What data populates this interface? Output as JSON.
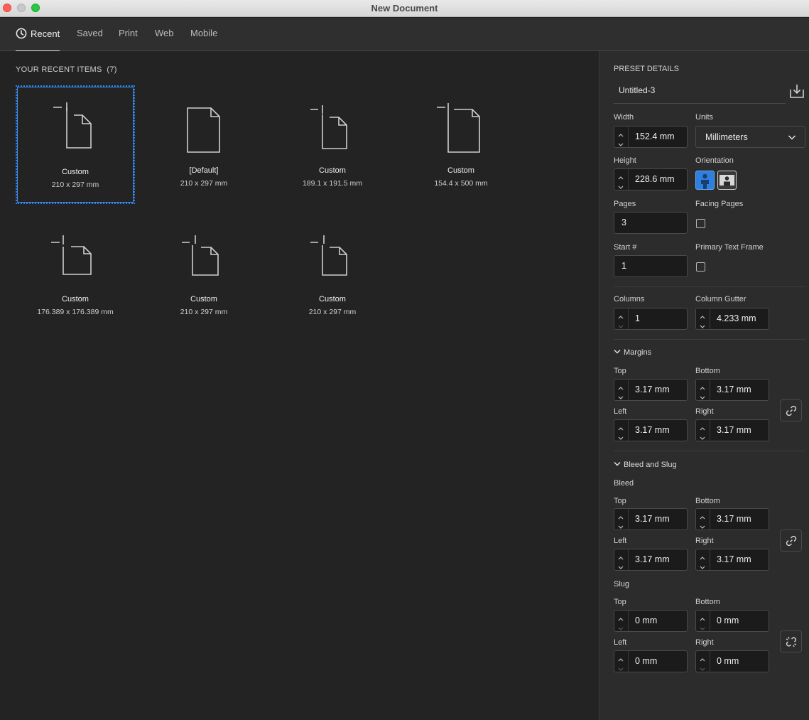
{
  "window": {
    "title": "New Document"
  },
  "tabs": [
    {
      "label": "Recent",
      "active": true,
      "icon": "clock-icon"
    },
    {
      "label": "Saved",
      "active": false
    },
    {
      "label": "Print",
      "active": false
    },
    {
      "label": "Web",
      "active": false
    },
    {
      "label": "Mobile",
      "active": false
    }
  ],
  "recent": {
    "heading": "YOUR RECENT ITEMS",
    "count": "(7)",
    "items": [
      {
        "name": "Custom",
        "size": "210 x 297 mm",
        "icon": "custom-document-icon",
        "selected": true
      },
      {
        "name": "[Default]",
        "size": "210 x 297 mm",
        "icon": "document-icon",
        "selected": false
      },
      {
        "name": "Custom",
        "size": "189.1 x 191.5 mm",
        "icon": "custom-document-icon",
        "selected": false
      },
      {
        "name": "Custom",
        "size": "154.4 x 500 mm",
        "icon": "custom-document-icon",
        "selected": false
      },
      {
        "name": "Custom",
        "size": "176.389 x 176.389 mm",
        "icon": "custom-document-icon",
        "selected": false
      },
      {
        "name": "Custom",
        "size": "210 x 297 mm",
        "icon": "custom-document-icon",
        "selected": false
      },
      {
        "name": "Custom",
        "size": "210 x 297 mm",
        "icon": "custom-document-icon",
        "selected": false
      }
    ]
  },
  "preset": {
    "heading": "PRESET DETAILS",
    "name": "Untitled-3",
    "save_icon": "save-preset-icon",
    "width_label": "Width",
    "width": "152.4 mm",
    "units_label": "Units",
    "units": "Millimeters",
    "height_label": "Height",
    "height": "228.6 mm",
    "orientation_label": "Orientation",
    "orientation": "portrait",
    "pages_label": "Pages",
    "pages": "3",
    "facing_label": "Facing Pages",
    "facing_checked": false,
    "start_label": "Start #",
    "start": "1",
    "ptf_label": "Primary Text Frame",
    "ptf_checked": false,
    "columns_label": "Columns",
    "columns": "1",
    "gutter_label": "Column Gutter",
    "gutter": "4.233 mm"
  },
  "margins": {
    "heading": "Margins",
    "top_label": "Top",
    "top": "3.17 mm",
    "bottom_label": "Bottom",
    "bottom": "3.17 mm",
    "left_label": "Left",
    "left": "3.17 mm",
    "right_label": "Right",
    "right": "3.17 mm"
  },
  "bleed_slug": {
    "heading": "Bleed and Slug",
    "bleed_label": "Bleed",
    "bleed": {
      "top_label": "Top",
      "top": "3.17 mm",
      "bottom_label": "Bottom",
      "bottom": "3.17 mm",
      "left_label": "Left",
      "left": "3.17 mm",
      "right_label": "Right",
      "right": "3.17 mm"
    },
    "slug_label": "Slug",
    "slug": {
      "top_label": "Top",
      "top": "0 mm",
      "bottom_label": "Bottom",
      "bottom": "0 mm",
      "left_label": "Left",
      "left": "0 mm",
      "right_label": "Right",
      "right": "0 mm"
    }
  },
  "colors": {
    "accent": "#2d7fe0",
    "panel": "#2c2c2c",
    "background": "#232323"
  }
}
